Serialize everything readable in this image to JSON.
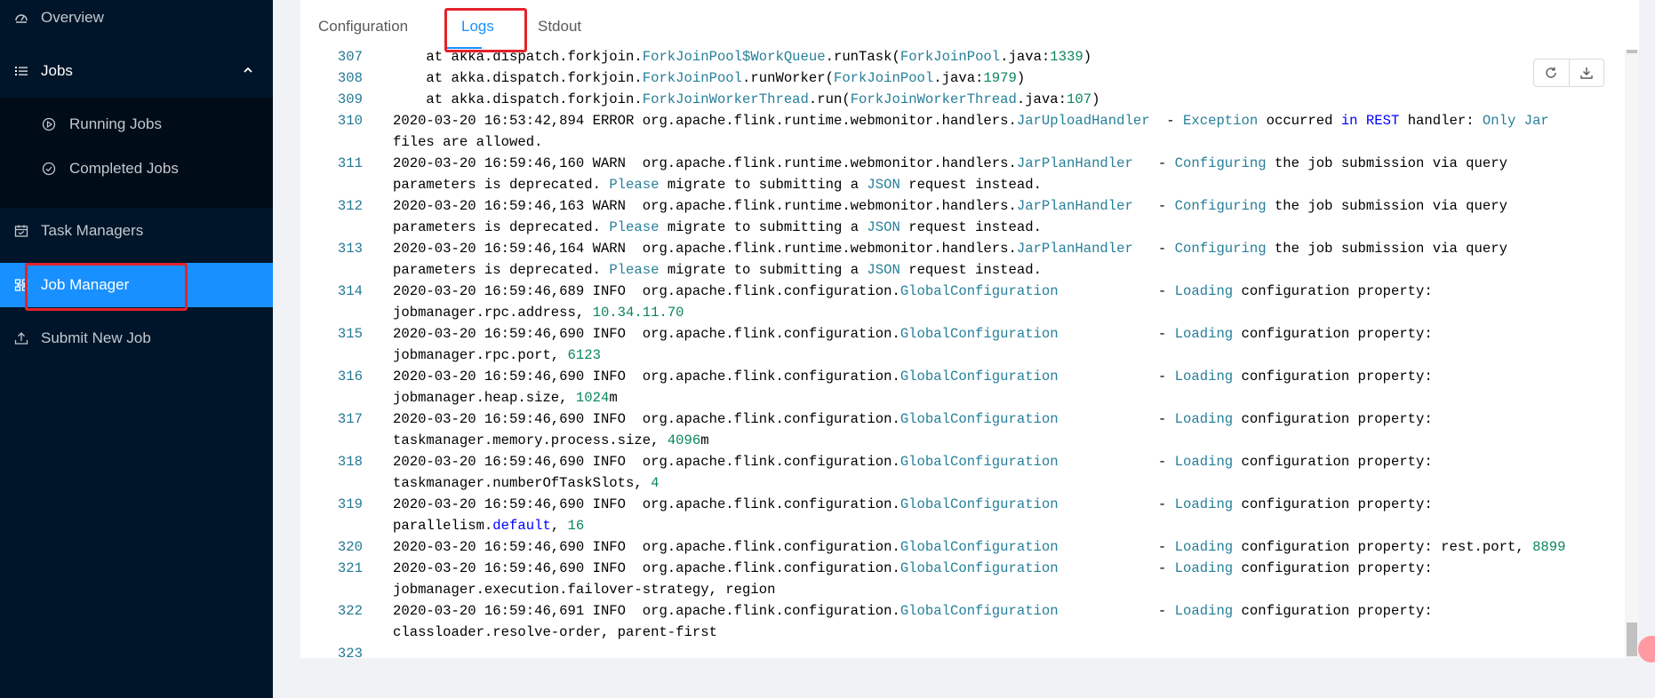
{
  "sidebar": {
    "items": [
      {
        "label": "Overview",
        "icon": "dashboard-icon"
      },
      {
        "label": "Jobs",
        "icon": "list-icon"
      },
      {
        "label": "Running Jobs",
        "icon": "play-circle-icon"
      },
      {
        "label": "Completed Jobs",
        "icon": "check-circle-icon"
      },
      {
        "label": "Task Managers",
        "icon": "calendar-icon"
      },
      {
        "label": "Job Manager",
        "icon": "cluster-icon"
      },
      {
        "label": "Submit New Job",
        "icon": "upload-icon"
      }
    ]
  },
  "tabs": [
    {
      "label": "Configuration"
    },
    {
      "label": "Logs"
    },
    {
      "label": "Stdout"
    }
  ],
  "toolbar": {
    "refresh_icon": "reload-icon",
    "download_icon": "download-icon"
  },
  "colors": {
    "sidebar_bg": "#001529",
    "accent": "#1890ff",
    "highlight": "#e3222c"
  },
  "log": {
    "lines": [
      {
        "n": "307",
        "t": "    at akka.dispatch.forkjoin.ForkJoinPool$WorkQueue.runTask(ForkJoinPool.java:1339)"
      },
      {
        "n": "308",
        "t": "    at akka.dispatch.forkjoin.ForkJoinPool.runWorker(ForkJoinPool.java:1979)"
      },
      {
        "n": "309",
        "t": "    at akka.dispatch.forkjoin.ForkJoinWorkerThread.run(ForkJoinWorkerThread.java:107)"
      },
      {
        "n": "310",
        "t": "2020-03-20 16:53:42,894 ERROR org.apache.flink.runtime.webmonitor.handlers.JarUploadHandler  - Exception occurred in REST handler: Only Jar"
      },
      {
        "n": "",
        "t": "files are allowed."
      },
      {
        "n": "311",
        "t": "2020-03-20 16:59:46,160 WARN  org.apache.flink.runtime.webmonitor.handlers.JarPlanHandler   - Configuring the job submission via query"
      },
      {
        "n": "",
        "t": "parameters is deprecated. Please migrate to submitting a JSON request instead."
      },
      {
        "n": "312",
        "t": "2020-03-20 16:59:46,163 WARN  org.apache.flink.runtime.webmonitor.handlers.JarPlanHandler   - Configuring the job submission via query"
      },
      {
        "n": "",
        "t": "parameters is deprecated. Please migrate to submitting a JSON request instead."
      },
      {
        "n": "313",
        "t": "2020-03-20 16:59:46,164 WARN  org.apache.flink.runtime.webmonitor.handlers.JarPlanHandler   - Configuring the job submission via query"
      },
      {
        "n": "",
        "t": "parameters is deprecated. Please migrate to submitting a JSON request instead."
      },
      {
        "n": "314",
        "t": "2020-03-20 16:59:46,689 INFO  org.apache.flink.configuration.GlobalConfiguration            - Loading configuration property:"
      },
      {
        "n": "",
        "t": "jobmanager.rpc.address, 10.34.11.70"
      },
      {
        "n": "315",
        "t": "2020-03-20 16:59:46,690 INFO  org.apache.flink.configuration.GlobalConfiguration            - Loading configuration property:"
      },
      {
        "n": "",
        "t": "jobmanager.rpc.port, 6123"
      },
      {
        "n": "316",
        "t": "2020-03-20 16:59:46,690 INFO  org.apache.flink.configuration.GlobalConfiguration            - Loading configuration property:"
      },
      {
        "n": "",
        "t": "jobmanager.heap.size, 1024m"
      },
      {
        "n": "317",
        "t": "2020-03-20 16:59:46,690 INFO  org.apache.flink.configuration.GlobalConfiguration            - Loading configuration property:"
      },
      {
        "n": "",
        "t": "taskmanager.memory.process.size, 4096m"
      },
      {
        "n": "318",
        "t": "2020-03-20 16:59:46,690 INFO  org.apache.flink.configuration.GlobalConfiguration            - Loading configuration property:"
      },
      {
        "n": "",
        "t": "taskmanager.numberOfTaskSlots, 4"
      },
      {
        "n": "319",
        "t": "2020-03-20 16:59:46,690 INFO  org.apache.flink.configuration.GlobalConfiguration            - Loading configuration property:"
      },
      {
        "n": "",
        "t": "parallelism.default, 16"
      },
      {
        "n": "320",
        "t": "2020-03-20 16:59:46,690 INFO  org.apache.flink.configuration.GlobalConfiguration            - Loading configuration property: rest.port, 8899"
      },
      {
        "n": "321",
        "t": "2020-03-20 16:59:46,690 INFO  org.apache.flink.configuration.GlobalConfiguration            - Loading configuration property:"
      },
      {
        "n": "",
        "t": "jobmanager.execution.failover-strategy, region"
      },
      {
        "n": "322",
        "t": "2020-03-20 16:59:46,691 INFO  org.apache.flink.configuration.GlobalConfiguration            - Loading configuration property:"
      },
      {
        "n": "",
        "t": "classloader.resolve-order, parent-first"
      },
      {
        "n": "323",
        "t": ""
      }
    ]
  }
}
